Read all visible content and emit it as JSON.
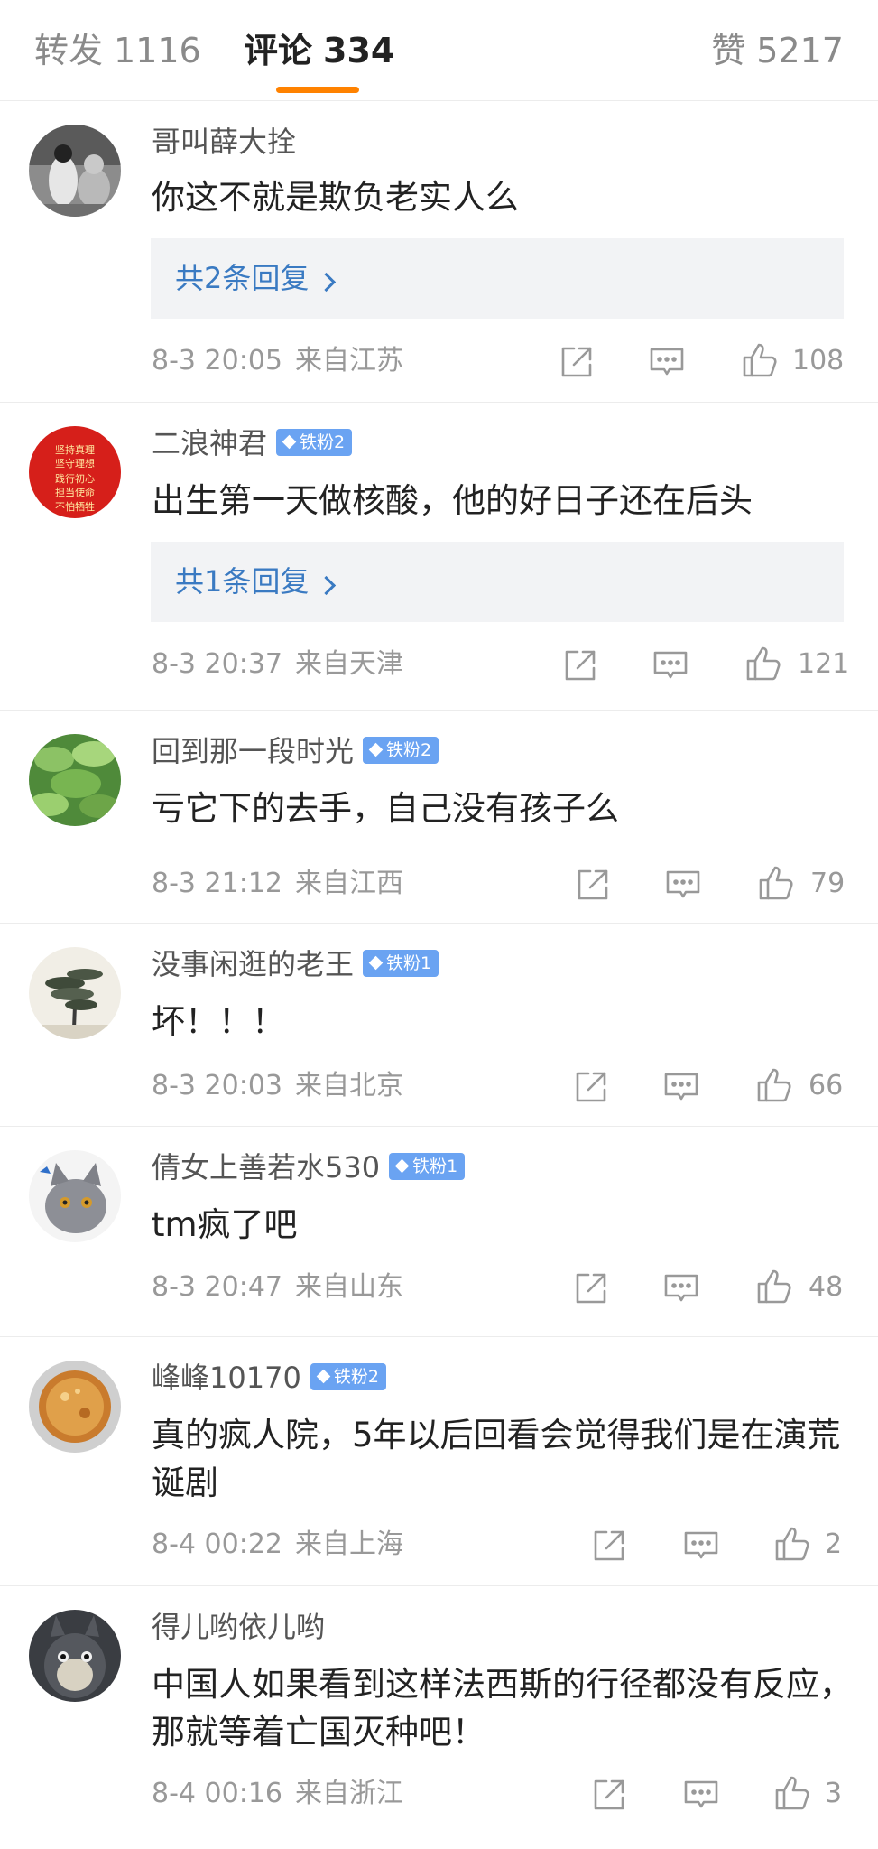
{
  "tabs": {
    "repost": {
      "label": "转发",
      "count": "1116"
    },
    "comments": {
      "label": "评论",
      "count": "334"
    },
    "likes": {
      "label": "赞",
      "count": "5217"
    }
  },
  "avatar_banner_text": [
    "坚持真理",
    "坚守理想",
    "践行初心",
    "担当使命",
    "不怕牺牲"
  ],
  "colors": {
    "accent": "#ff8200",
    "link": "#3a7ac2",
    "badge": "#6aa3f2"
  },
  "comments": [
    {
      "user": "哥叫薛大拴",
      "badge": "",
      "text": "你这不就是欺负老实人么",
      "replies": "共2条回复",
      "time": "8-3 20:05",
      "source": "来自江苏",
      "likes": "108"
    },
    {
      "user": "二浪神君",
      "badge": "铁粉2",
      "text": "出生第一天做核酸，他的好日子还在后头",
      "replies": "共1条回复",
      "time": "8-3 20:37",
      "source": "来自天津",
      "likes": "121"
    },
    {
      "user": "回到那一段时光",
      "badge": "铁粉2",
      "text": "亏它下的去手，自己没有孩子么",
      "replies": "",
      "time": "8-3 21:12",
      "source": "来自江西",
      "likes": "79"
    },
    {
      "user": "没事闲逛的老王",
      "badge": "铁粉1",
      "text": "坏！！！",
      "replies": "",
      "time": "8-3 20:03",
      "source": "来自北京",
      "likes": "66"
    },
    {
      "user": "倩女上善若水530",
      "badge": "铁粉1",
      "text": "tm疯了吧",
      "replies": "",
      "time": "8-3 20:47",
      "source": "来自山东",
      "likes": "48"
    },
    {
      "user": "峰峰10170",
      "badge": "铁粉2",
      "text": "真的疯人院，5年以后回看会觉得我们是在演荒诞剧",
      "replies": "",
      "time": "8-4 00:22",
      "source": "来自上海",
      "likes": "2"
    },
    {
      "user": "得儿哟依儿哟",
      "badge": "",
      "text": "中国人如果看到这样法西斯的行径都没有反应，那就等着亡国灭种吧！",
      "replies": "",
      "time": "8-4 00:16",
      "source": "来自浙江",
      "likes": "3"
    }
  ],
  "icons": {
    "share": "share-icon",
    "comment": "comment-icon",
    "like": "thumbs-up-icon"
  }
}
